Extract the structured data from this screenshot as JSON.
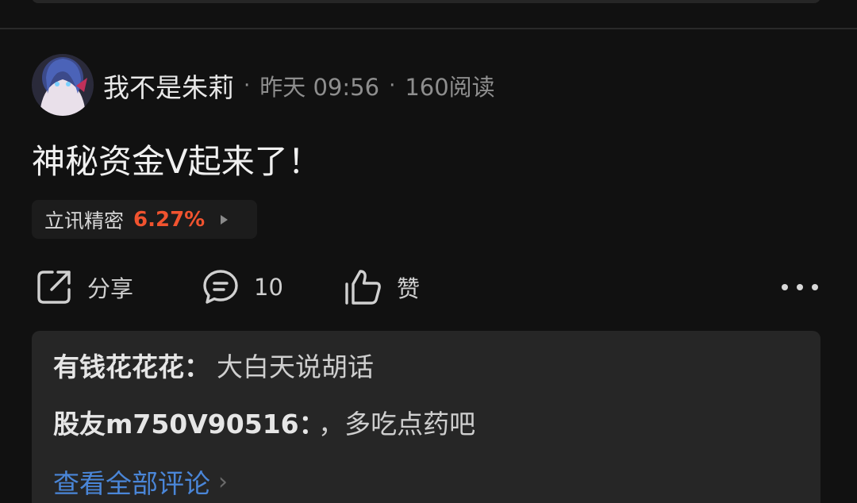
{
  "post": {
    "author": "我不是朱莉",
    "separator": "·",
    "time": "昨天 09:56",
    "views": "160阅读",
    "text": "神秘资金V起来了！",
    "stock": {
      "name": "立讯精密",
      "change": "6.27%",
      "change_color": "#f1532f"
    }
  },
  "actions": {
    "share_label": "分享",
    "comment_count": "10",
    "like_label": "赞"
  },
  "comments": [
    {
      "user": "有钱花花花",
      "colon": "：",
      "text": "大白天说胡话"
    },
    {
      "user": "股友m750V90516",
      "colon": "：",
      "text": "，多吃点药吧"
    }
  ],
  "view_all_label": "查看全部评论",
  "colors": {
    "background": "#111111",
    "card": "#262626",
    "link": "#4a86d8"
  }
}
